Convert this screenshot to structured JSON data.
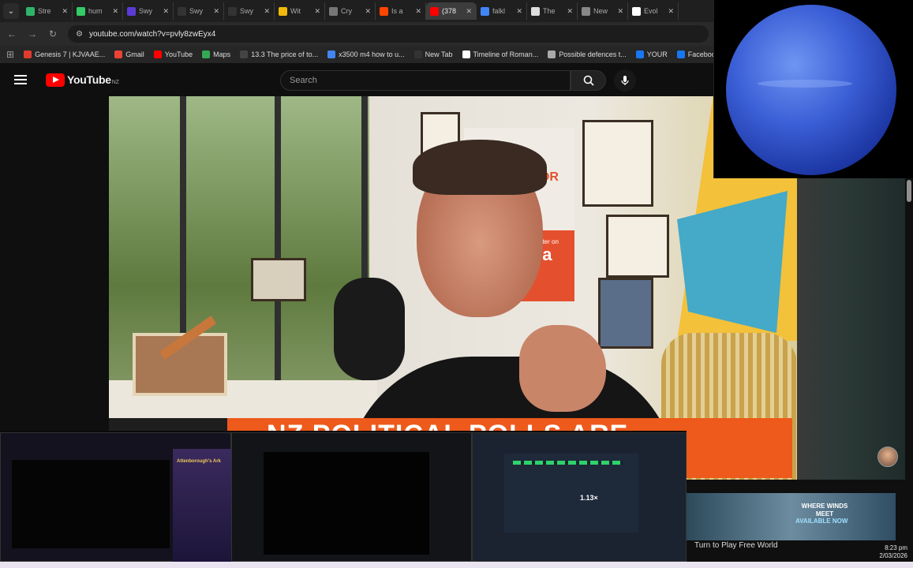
{
  "tabs": [
    {
      "title": "Stre",
      "color": "#2fb36a"
    },
    {
      "title": "hum",
      "color": "#33cc66"
    },
    {
      "title": "Swy",
      "color": "#5b3bd6"
    },
    {
      "title": "Swy",
      "color": "#333333"
    },
    {
      "title": "Swy",
      "color": "#333333"
    },
    {
      "title": "Wit",
      "color": "#f0b90b"
    },
    {
      "title": "Cry",
      "color": "#777777"
    },
    {
      "title": "Is a",
      "color": "#ff4500"
    },
    {
      "title": "(378",
      "color": "#ff0000",
      "active": true
    },
    {
      "title": "falkl",
      "color": "#4285f4"
    },
    {
      "title": "The",
      "color": "#dddddd"
    },
    {
      "title": "New",
      "color": "#888888"
    },
    {
      "title": "Evol",
      "color": "#ffffff"
    }
  ],
  "address": {
    "url": "youtube.com/watch?v=pvly8zwEyx4"
  },
  "bookmarks": [
    {
      "label": "Genesis 7 | KJVAAE...",
      "color": "#e03b2e"
    },
    {
      "label": "Gmail",
      "color": "#ea4335"
    },
    {
      "label": "YouTube",
      "color": "#ff0000"
    },
    {
      "label": "Maps",
      "color": "#34a853"
    },
    {
      "label": "13.3 The price of to...",
      "color": "#444444"
    },
    {
      "label": "x3500 m4 how to u...",
      "color": "#4285f4"
    },
    {
      "label": "New Tab",
      "color": "#333333"
    },
    {
      "label": "Timeline of Roman...",
      "color": "#ffffff"
    },
    {
      "label": "Possible defences t...",
      "color": "#aaaaaa"
    },
    {
      "label": "YOUR",
      "color": "#1877f2"
    },
    {
      "label": "Facebook green",
      "color": "#1877f2"
    }
  ],
  "youtube": {
    "logo_text": "YouTube",
    "country": "NZ",
    "search_placeholder": "Search"
  },
  "video": {
    "banner_text": "TURNER FOR CHIEF",
    "banner_sub": "Live or later on",
    "banner_brand": "rova",
    "headline": "NZ POLITICAL POLLS ARE"
  },
  "ad": {
    "line1": "WHERE WINDS MEET",
    "line2": "AVAILABLE NOW",
    "caption": "Turn to Play Free World"
  },
  "previews": {
    "p1_title": "Attenborough's Ark",
    "multiplier": "1.13×"
  },
  "clock": {
    "time": "8:23 pm",
    "date": "2/03/2026"
  }
}
